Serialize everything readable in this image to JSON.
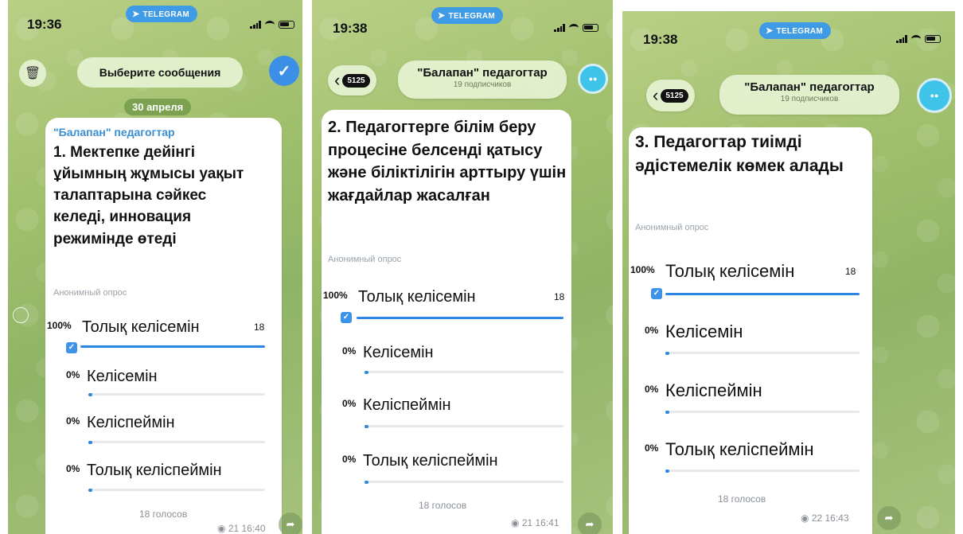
{
  "screens": [
    {
      "time": "19:36",
      "telegram_label": "TELEGRAM",
      "select_label": "Выберите сообщения",
      "date": "30 апреля",
      "channel": "\"Балапан\" педагогтар",
      "question": "1. Мектепке дейінгі ұйымның жұмысы уақыт талаптарына сәйкес келеді, инновация режимінде өтеді",
      "poll_type": "Анонимный опрос",
      "options": [
        {
          "percent": "100%",
          "label": "Толық келісемін",
          "votes": "18",
          "fill": 1.0,
          "checked": true
        },
        {
          "percent": "0%",
          "label": "Келісемін",
          "fill": 0.0
        },
        {
          "percent": "0%",
          "label": "Келіспеймін",
          "fill": 0.0
        },
        {
          "percent": "0%",
          "label": "Толық келіспеймін",
          "fill": 0.0
        }
      ],
      "total": "18 голосов",
      "views_time": "21 16:40"
    },
    {
      "time": "19:38",
      "telegram_label": "TELEGRAM",
      "back_count": "5125",
      "channel_title": "\"Балапан\" педагогтар",
      "subscribers": "19 подписчиков",
      "question": "2. Педагогтерге білім беру процесіне белсенді қатысу және біліктілігін арттыру үшін жағдайлар жасалған",
      "poll_type": "Анонимный опрос",
      "options": [
        {
          "percent": "100%",
          "label": "Толық келісемін",
          "votes": "18",
          "fill": 1.0,
          "checked": true
        },
        {
          "percent": "0%",
          "label": "Келісемін",
          "fill": 0.0
        },
        {
          "percent": "0%",
          "label": "Келіспеймін",
          "fill": 0.0
        },
        {
          "percent": "0%",
          "label": "Толық келіспеймін",
          "fill": 0.0
        }
      ],
      "total": "18 голосов",
      "views_time": "21 16:41"
    },
    {
      "time": "19:38",
      "telegram_label": "TELEGRAM",
      "back_count": "5125",
      "channel_title": "\"Балапан\" педагогтар",
      "subscribers": "19 подписчиков",
      "question": "3. Педагогтар тиімді әдістемелік көмек алады",
      "poll_type": "Анонимный опрос",
      "options": [
        {
          "percent": "100%",
          "label": "Толық келісемін",
          "votes": "18",
          "fill": 1.0,
          "checked": true
        },
        {
          "percent": "0%",
          "label": "Келісемін",
          "fill": 0.0
        },
        {
          "percent": "0%",
          "label": "Келіспеймін",
          "fill": 0.0
        },
        {
          "percent": "0%",
          "label": "Толық келіспеймін",
          "fill": 0.0
        }
      ],
      "total": "18 голосов",
      "views_time": "22 16:43"
    }
  ],
  "colors": {
    "accent": "#2c87e0",
    "channel": "#3a8ed4",
    "telegram": "#3f9be6"
  },
  "icons": {
    "trash": "trash-icon",
    "check": "check-icon",
    "back": "chevron-left-icon",
    "share": "share-icon",
    "views": "eye-icon",
    "telegram": "telegram-plane-icon"
  }
}
